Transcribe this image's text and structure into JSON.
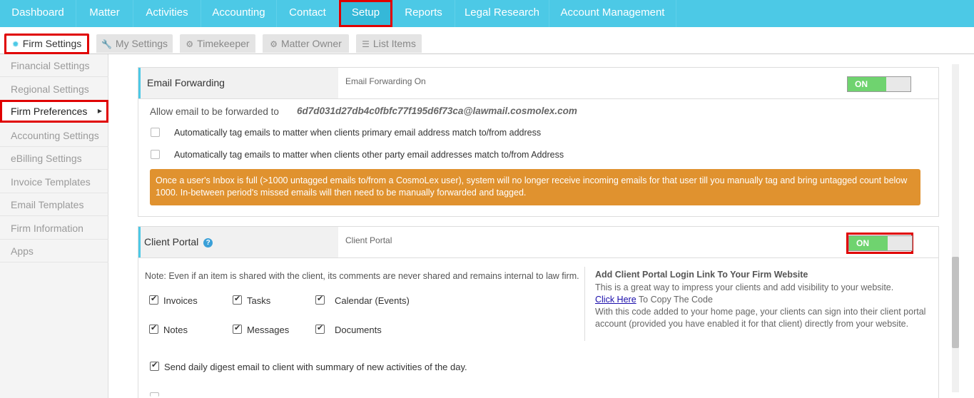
{
  "topnav": {
    "items": [
      "Dashboard",
      "Matter",
      "Activities",
      "Accounting",
      "Contact",
      "Setup",
      "Reports",
      "Legal Research",
      "Account Management"
    ]
  },
  "subtabs": {
    "items": [
      {
        "label": "Firm Settings",
        "icon": "gear-icon"
      },
      {
        "label": "My Settings",
        "icon": "wrench-icon"
      },
      {
        "label": "Timekeeper",
        "icon": "gears-icon"
      },
      {
        "label": "Matter Owner",
        "icon": "gear-icon"
      },
      {
        "label": "List Items",
        "icon": "list-icon"
      }
    ]
  },
  "sidebar": {
    "items": [
      "Financial Settings",
      "Regional Settings",
      "Firm Preferences",
      "Accounting Settings",
      "eBilling Settings",
      "Invoice Templates",
      "Email Templates",
      "Firm Information",
      "Apps"
    ]
  },
  "email_forwarding": {
    "title": "Email Forwarding",
    "subtitle": "Email Forwarding On",
    "toggle": "ON",
    "allow_label": "Allow email to be forwarded to",
    "address": "6d7d031d27db4c0fbfc77f195d6f73ca@lawmail.cosmolex.com",
    "option1": "Automatically tag emails to matter when clients primary email address match to/from address",
    "option2": "Automatically tag emails to matter when clients other party email addresses match to/from Address",
    "warning": "Once a user's Inbox is full (>1000 untagged emails to/from a CosmoLex user), system will no longer receive incoming emails for that user till you manually tag and bring untagged count below 1000. In-between period's missed emails will then need to be manually forwarded and tagged."
  },
  "client_portal": {
    "title": "Client Portal",
    "subtitle": "Client Portal",
    "toggle": "ON",
    "note": "Note: Even if an item is shared with the client, its comments are never shared and remains internal to law firm.",
    "share_items": [
      "Invoices",
      "Tasks",
      "Calendar (Events)",
      "Notes",
      "Messages",
      "Documents"
    ],
    "digest": "Send daily digest email to client with summary of new activities of the day.",
    "link_title": "Add Client Portal Login Link To Your Firm Website",
    "link_line1": "This is a great way to impress your clients and add visibility to your website.",
    "click_here": "Click Here",
    "copy_code": "To Copy The Code",
    "link_line3": "With this code added to your home page, your clients can sign into their client portal",
    "link_line4": "account (provided you have enabled it for that client) directly from your website."
  },
  "colors": {
    "nav": "#4cc9e6",
    "highlight": "#e00000",
    "warning": "#e0922f",
    "toggle_on": "#6fd36f"
  }
}
